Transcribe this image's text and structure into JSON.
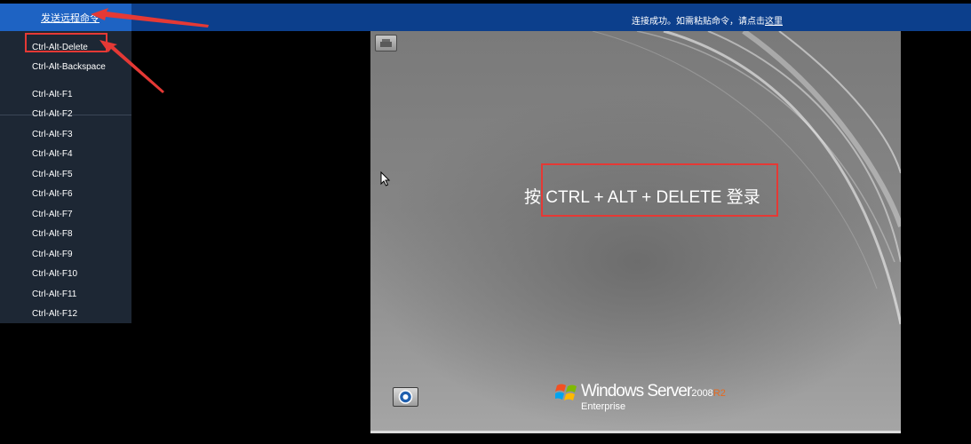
{
  "toolbar": {
    "send_remote_label": "发送远程命令",
    "status_text": "连接成功。如需粘贴命令，请点击",
    "status_link": "这里"
  },
  "menu": {
    "items": [
      "Ctrl-Alt-Delete",
      "Ctrl-Alt-Backspace",
      "Ctrl-Alt-F1",
      "Ctrl-Alt-F2",
      "Ctrl-Alt-F3",
      "Ctrl-Alt-F4",
      "Ctrl-Alt-F5",
      "Ctrl-Alt-F6",
      "Ctrl-Alt-F7",
      "Ctrl-Alt-F8",
      "Ctrl-Alt-F9",
      "Ctrl-Alt-F10",
      "Ctrl-Alt-F11",
      "Ctrl-Alt-F12"
    ]
  },
  "screen": {
    "login_prompt": "按 CTRL + ALT + DELETE 登录",
    "brand_name": "Windows Server",
    "brand_version": "2008",
    "brand_release": "R2",
    "brand_edition": "Enterprise",
    "top_icon": "keyboard-icon",
    "ease_icon": "ease-of-access-icon"
  },
  "colors": {
    "topbar": "#0c3f8c",
    "send_button": "#1e63c3",
    "menu_bg": "#1d2734",
    "annotation": "#e53935",
    "release_accent": "#e66a1f"
  }
}
